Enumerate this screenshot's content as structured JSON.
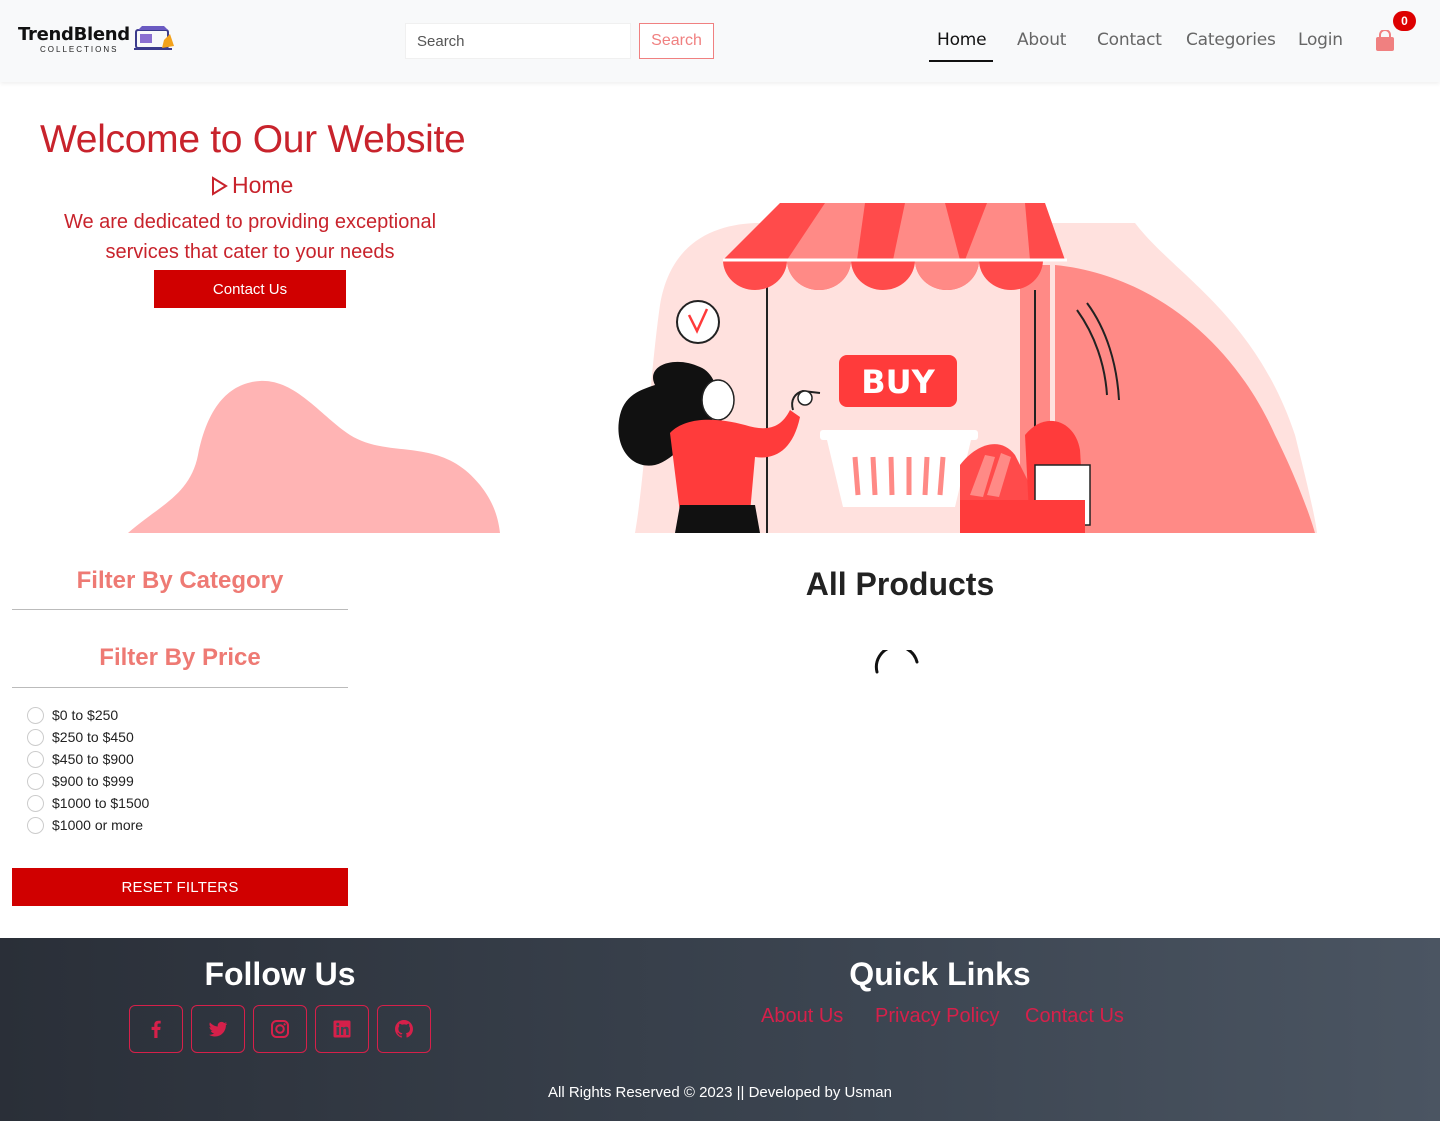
{
  "brand": {
    "name": "TrendBlend",
    "tagline": "COLLECTIONS"
  },
  "header": {
    "search": {
      "placeholder": "Search",
      "button_label": "Search"
    },
    "nav": [
      {
        "label": "Home"
      },
      {
        "label": "About"
      },
      {
        "label": "Contact"
      },
      {
        "label": "Categories"
      },
      {
        "label": "Login"
      }
    ],
    "active_nav": "Home",
    "cart_count": "0"
  },
  "hero": {
    "title": "Welcome to Our Website",
    "breadcrumb": "Home",
    "description": "We are dedicated to providing exceptional services that cater to your needs",
    "cta_label": "Contact Us",
    "illustration_sign": "BUY"
  },
  "filters": {
    "category_heading": "Filter By Category",
    "price_heading": "Filter By Price",
    "price_options": [
      "$0 to $250",
      "$250 to $450",
      "$450 to $900",
      "$900 to $999",
      "$1000 to $1500",
      "$1000 or more"
    ],
    "reset_label": "RESET FILTERS"
  },
  "products": {
    "title": "All Products"
  },
  "footer": {
    "follow_heading": "Follow Us",
    "social_icons": [
      "facebook-icon",
      "twitter-icon",
      "instagram-icon",
      "linkedin-icon",
      "github-icon"
    ],
    "quick_links_heading": "Quick Links",
    "quick_links": [
      "About Us",
      "Privacy Policy",
      "Contact Us"
    ],
    "copyright": "All Rights Reserved © 2023 || Developed by Usman"
  },
  "colors": {
    "accent_red": "#d00000",
    "text_red": "#c8232c",
    "filter_pink": "#ee7a74",
    "footer_link": "#d6204a"
  }
}
